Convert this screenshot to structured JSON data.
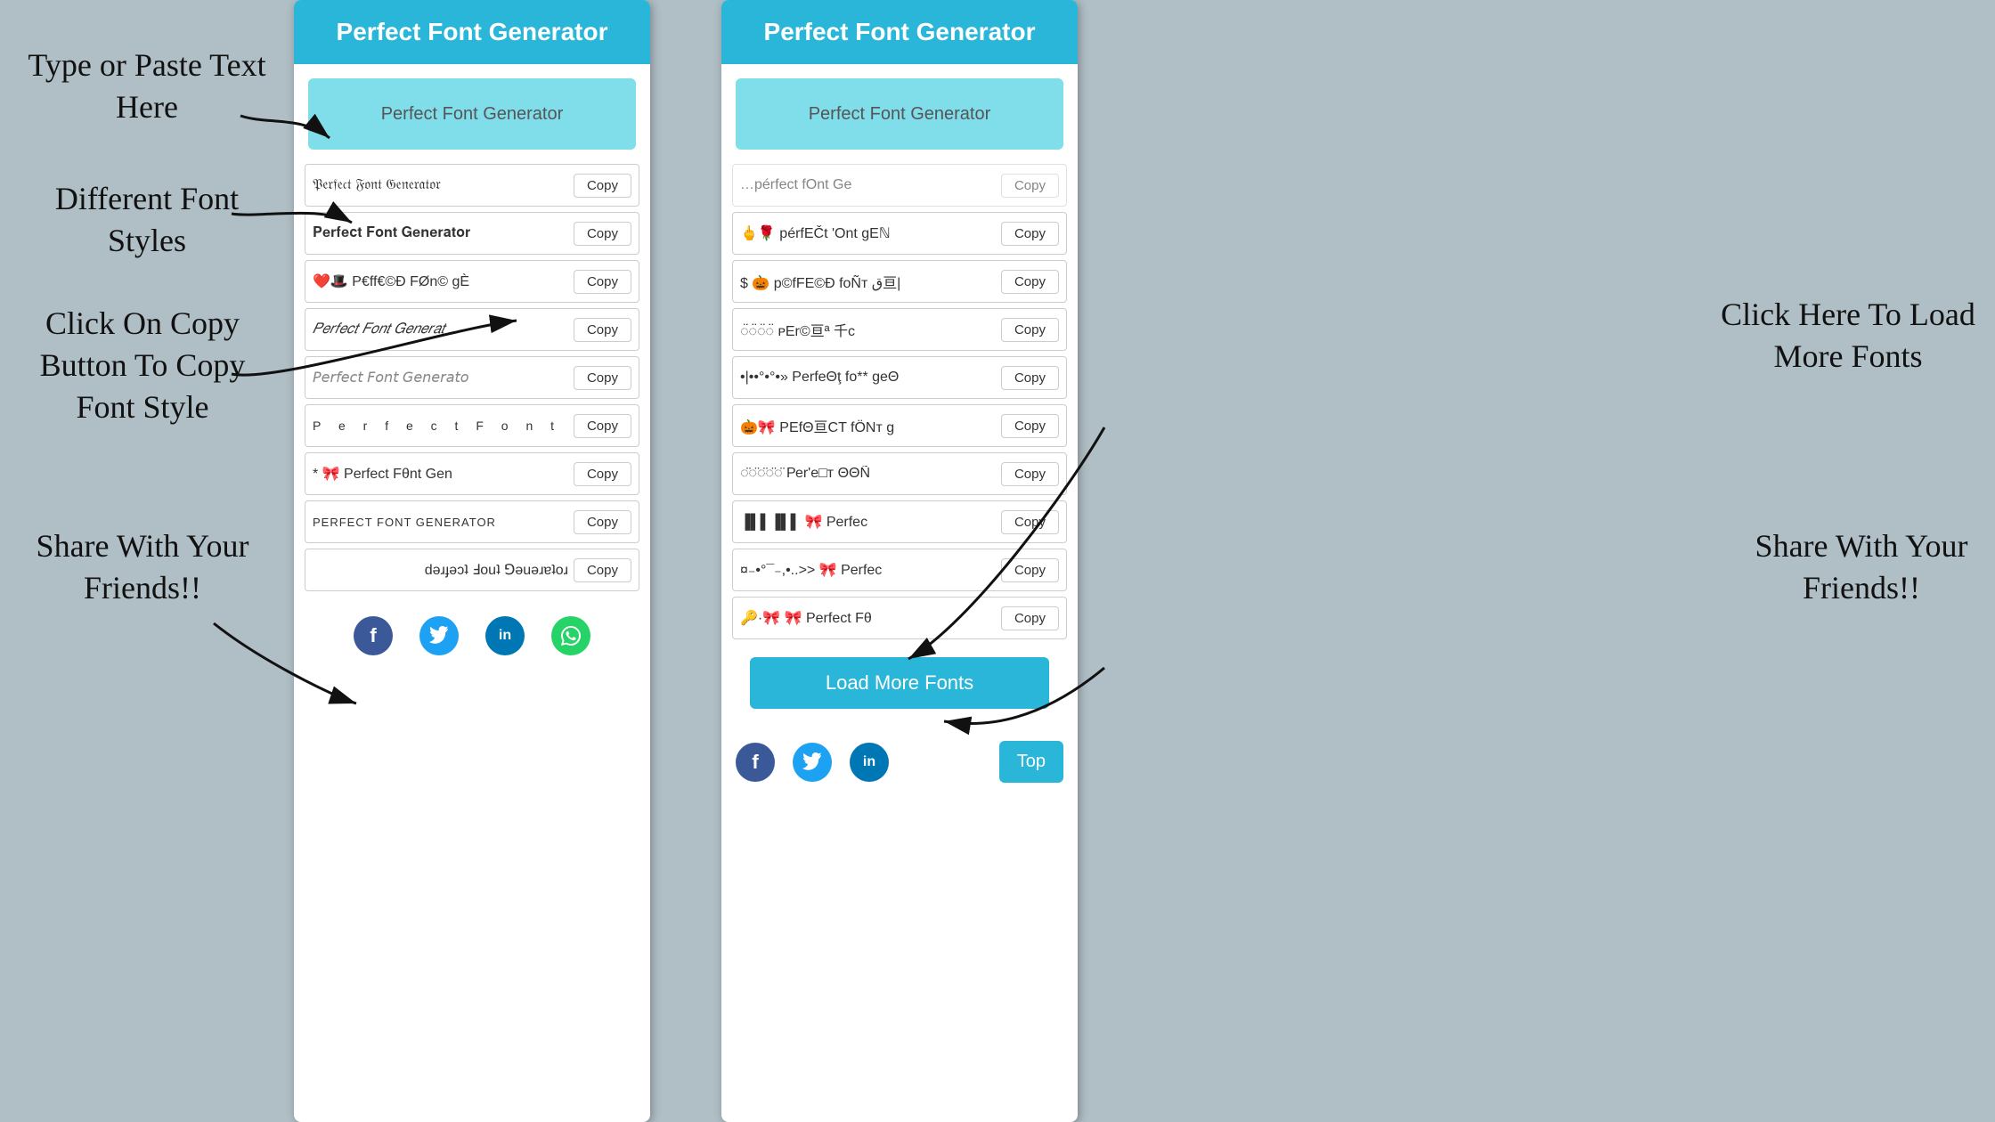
{
  "annotations": {
    "type_paste": "Type or Paste Text\nHere",
    "different_fonts": "Different Font\nStyles",
    "click_copy": "Click On Copy\nButton To Copy\nFont Style",
    "share_left": "Share With\nYour\nFriends!!",
    "load_more": "Click Here To\nLoad More\nFonts",
    "share_right": "Share With\nYour\nFriends!!"
  },
  "left_panel": {
    "title": "Perfect Font Generator",
    "input_placeholder": "Perfect Font Generator",
    "fonts": [
      {
        "text": "𝔓𝔢𝔯𝔣𝔢𝔠𝔱 𝔉𝔬𝔫𝔱 𝔊𝔢𝔫𝔢𝔯𝔞𝔱𝔬𝔯",
        "style": "fraktur",
        "copy": "Copy"
      },
      {
        "text": "𝐏𝐞𝐫𝐟𝐞𝐜𝐭 𝐅𝐨𝐧𝐭 𝐆𝐞𝐧𝐞𝐫𝐚𝐭𝐨𝐫",
        "style": "bold",
        "copy": "Copy"
      },
      {
        "text": "❤️🎩 P€ff€©Ð FØn© gÈ",
        "style": "emoji",
        "copy": "Copy"
      },
      {
        "text": "𝑃𝑒𝑟𝑓𝑒𝑐𝑡 𝐹𝑜𝑛𝑡 𝐺𝑒𝑛𝑒𝑟𝑎𝑡",
        "style": "italic",
        "copy": "Copy"
      },
      {
        "text": "𝘗𝘦𝘳𝘧𝘦𝘤𝘵 𝘍𝘰𝘯𝘵 𝘎𝘦𝘯𝘦𝘳𝘢𝘵𝘰",
        "style": "sans-italic",
        "copy": "Copy"
      },
      {
        "text": "P e r f e c t  F o n t",
        "style": "spaced",
        "copy": "Copy"
      },
      {
        "text": "* 🎀 Perfect Fθnt Gen",
        "style": "mixed",
        "copy": "Copy"
      },
      {
        "text": "PERFECT FONT GENERATOR",
        "style": "upper",
        "copy": "Copy"
      },
      {
        "text": "ɹoʇɐɹǝuǝ⅁ ʇuoℲ ʇɔǝɟɹǝd",
        "style": "flipped",
        "copy": "Copy"
      }
    ],
    "share": {
      "facebook": "f",
      "twitter": "t",
      "linkedin": "in",
      "whatsapp": "w"
    }
  },
  "right_panel": {
    "title": "Perfect Font Generator",
    "input_placeholder": "Perfect Font Generator",
    "fonts": [
      {
        "text": "🖕🌹 pérfEČt 'Ont gEℕ",
        "style": "emoji",
        "copy": "Copy"
      },
      {
        "text": "$ 🎃 p©fFE©Ð foÑт ق亘|",
        "style": "emoji2",
        "copy": "Copy"
      },
      {
        "text": "◌̈◌̈◌̈◌̈ ᴘEr©亘ª 千c",
        "style": "deco",
        "copy": "Copy"
      },
      {
        "text": "•|••°•°•» PerfеΘţ fo** geΘ",
        "style": "bullet",
        "copy": "Copy"
      },
      {
        "text": "🎃🎀 PEfΘ亘CT fÖNт g",
        "style": "emoji3",
        "copy": "Copy"
      },
      {
        "text": "◌̈◌̈◌̈◌̈◌̈ Реr'е□т ΘΘÑ",
        "style": "deco2",
        "copy": "Copy"
      },
      {
        "text": "▐▌▌▐▌▌ 🎀 Perfec",
        "style": "bar",
        "copy": "Copy"
      },
      {
        "text": "¤₋•°¯₋,•..>> 🎀 Perfec",
        "style": "fancy",
        "copy": "Copy"
      },
      {
        "text": "🔑·🎀 🎀 Perfect Fθ",
        "style": "key",
        "copy": "Copy"
      }
    ],
    "load_more_btn": "Load More Fonts",
    "top_btn": "Top",
    "share": {
      "facebook": "f",
      "twitter": "t",
      "linkedin": "in"
    }
  }
}
